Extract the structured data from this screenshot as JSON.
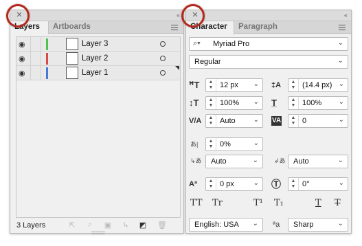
{
  "layers_panel": {
    "tabs": [
      "Layers",
      "Artboards"
    ],
    "layers": [
      {
        "name": "Layer 3",
        "color": "#4fc34f"
      },
      {
        "name": "Layer 2",
        "color": "#d94b4b"
      },
      {
        "name": "Layer 1",
        "color": "#4a78d8"
      }
    ],
    "count_label": "3 Layers",
    "footer_icons": [
      "export-icon",
      "locate-object-icon",
      "make-clipping-mask-icon",
      "new-sublayer-icon",
      "new-layer-icon",
      "delete-icon"
    ]
  },
  "character_panel": {
    "tabs": [
      "Character",
      "Paragraph"
    ],
    "font_family": "Myriad Pro",
    "font_style": "Regular",
    "font_size": "12 px",
    "leading": "(14.4 px)",
    "vertical_scale": "100%",
    "horizontal_scale": "100%",
    "kerning": "Auto",
    "tracking": "0",
    "tsume": "0%",
    "aki_left": "Auto",
    "aki_right": "Auto",
    "baseline_shift": "0 px",
    "rotation": "0°",
    "style_buttons": [
      "TT",
      "Tr",
      "T¹",
      "T₁",
      "T",
      "T"
    ],
    "language": "English: USA",
    "anti_alias_label": "ªa",
    "anti_alias": "Sharp"
  }
}
